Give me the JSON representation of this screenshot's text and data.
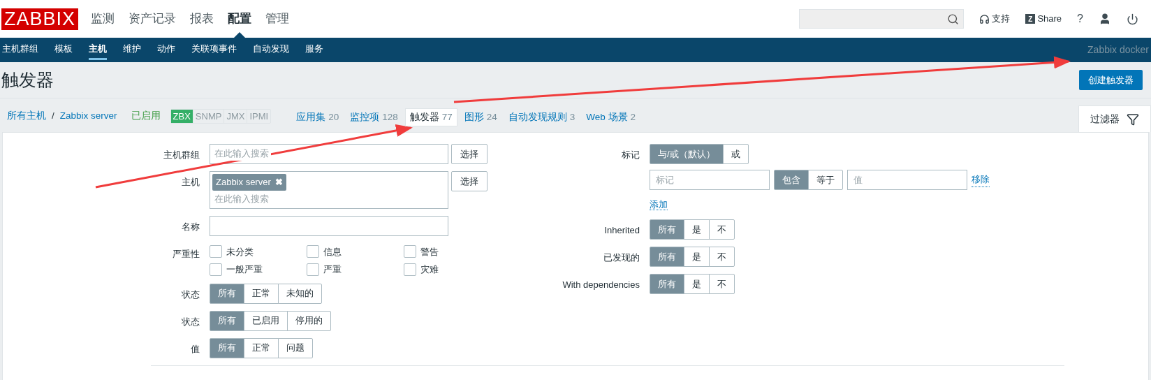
{
  "logo": "ZABBIX",
  "main_menu": [
    {
      "label": "监测",
      "selected": false
    },
    {
      "label": "资产记录",
      "selected": false
    },
    {
      "label": "报表",
      "selected": false
    },
    {
      "label": "配置",
      "selected": true
    },
    {
      "label": "管理",
      "selected": false
    }
  ],
  "header_links": [
    {
      "kind": "support",
      "label": "支持"
    },
    {
      "kind": "share",
      "label": "Share",
      "badge": "Z"
    },
    {
      "kind": "help",
      "label": "?"
    },
    {
      "kind": "user"
    },
    {
      "kind": "logout"
    }
  ],
  "sub_menu": [
    {
      "label": "主机群组",
      "selected": false
    },
    {
      "label": "模板",
      "selected": false
    },
    {
      "label": "主机",
      "selected": true
    },
    {
      "label": "维护",
      "selected": false
    },
    {
      "label": "动作",
      "selected": false
    },
    {
      "label": "关联项事件",
      "selected": false
    },
    {
      "label": "自动发现",
      "selected": false
    },
    {
      "label": "服务",
      "selected": false
    }
  ],
  "server_name": "Zabbix docker",
  "page_title": "触发器",
  "create_button": "创建触发器",
  "breadcrumbs": [
    "所有主机",
    "/",
    "Zabbix server"
  ],
  "host_status": "已启用",
  "availability": [
    {
      "label": "ZBX",
      "on": true
    },
    {
      "label": "SNMP",
      "on": false
    },
    {
      "label": "JMX",
      "on": false
    },
    {
      "label": "IPMI",
      "on": false
    }
  ],
  "host_tabs": [
    {
      "label": "应用集",
      "count": "20",
      "selected": false
    },
    {
      "label": "监控项",
      "count": "128",
      "selected": false
    },
    {
      "label": "触发器",
      "count": "77",
      "selected": true
    },
    {
      "label": "图形",
      "count": "24",
      "selected": false
    },
    {
      "label": "自动发现规则",
      "count": "3",
      "selected": false
    },
    {
      "label": "Web 场景",
      "count": "2",
      "selected": false
    }
  ],
  "filter_tab": "过滤器",
  "filter_left": [
    {
      "kind": "multiselect",
      "label": "主机群组",
      "placeholder": "在此输入搜索",
      "button": "选择"
    },
    {
      "kind": "multiselect",
      "label": "主机",
      "chips": [
        "Zabbix server"
      ],
      "chip_remove": "✖",
      "placeholder": "在此输入搜索",
      "button": "选择"
    },
    {
      "kind": "text",
      "label": "名称"
    },
    {
      "kind": "checkboxes",
      "label": "严重性",
      "options": [
        {
          "label": "未分类",
          "checked": false
        },
        {
          "label": "信息",
          "checked": false
        },
        {
          "label": "警告",
          "checked": false
        },
        {
          "label": "一般严重",
          "checked": false
        },
        {
          "label": "严重",
          "checked": false
        },
        {
          "label": "灾难",
          "checked": false
        }
      ]
    },
    {
      "kind": "segmented",
      "label": "状态",
      "options": [
        {
          "label": "所有",
          "selected": true
        },
        {
          "label": "正常",
          "selected": false
        },
        {
          "label": "未知的",
          "selected": false
        }
      ]
    },
    {
      "kind": "segmented",
      "label": "状态",
      "options": [
        {
          "label": "所有",
          "selected": true
        },
        {
          "label": "已启用",
          "selected": false
        },
        {
          "label": "停用的",
          "selected": false
        }
      ]
    },
    {
      "kind": "segmented",
      "label": "值",
      "options": [
        {
          "label": "所有",
          "selected": true
        },
        {
          "label": "正常",
          "selected": false
        },
        {
          "label": "问题",
          "selected": false
        }
      ]
    }
  ],
  "filter_right": [
    {
      "kind": "tags",
      "label": "标记",
      "options": [
        {
          "label": "与/或（默认）",
          "selected": true
        },
        {
          "label": "或",
          "selected": false
        }
      ],
      "tag_placeholder": "标记",
      "operators": [
        {
          "label": "包含",
          "selected": true
        },
        {
          "label": "等于",
          "selected": false
        }
      ],
      "value_placeholder": "值",
      "remove": "移除",
      "add": "添加"
    },
    {
      "kind": "segmented",
      "label": "Inherited",
      "options": [
        {
          "label": "所有",
          "selected": true
        },
        {
          "label": "是",
          "selected": false
        },
        {
          "label": "不",
          "selected": false
        }
      ]
    },
    {
      "kind": "segmented",
      "label": "已发现的",
      "options": [
        {
          "label": "所有",
          "selected": true
        },
        {
          "label": "是",
          "selected": false
        },
        {
          "label": "不",
          "selected": false
        }
      ]
    },
    {
      "kind": "segmented",
      "label": "With dependencies",
      "options": [
        {
          "label": "所有",
          "selected": true
        },
        {
          "label": "是",
          "selected": false
        },
        {
          "label": "不",
          "selected": false
        }
      ]
    }
  ]
}
